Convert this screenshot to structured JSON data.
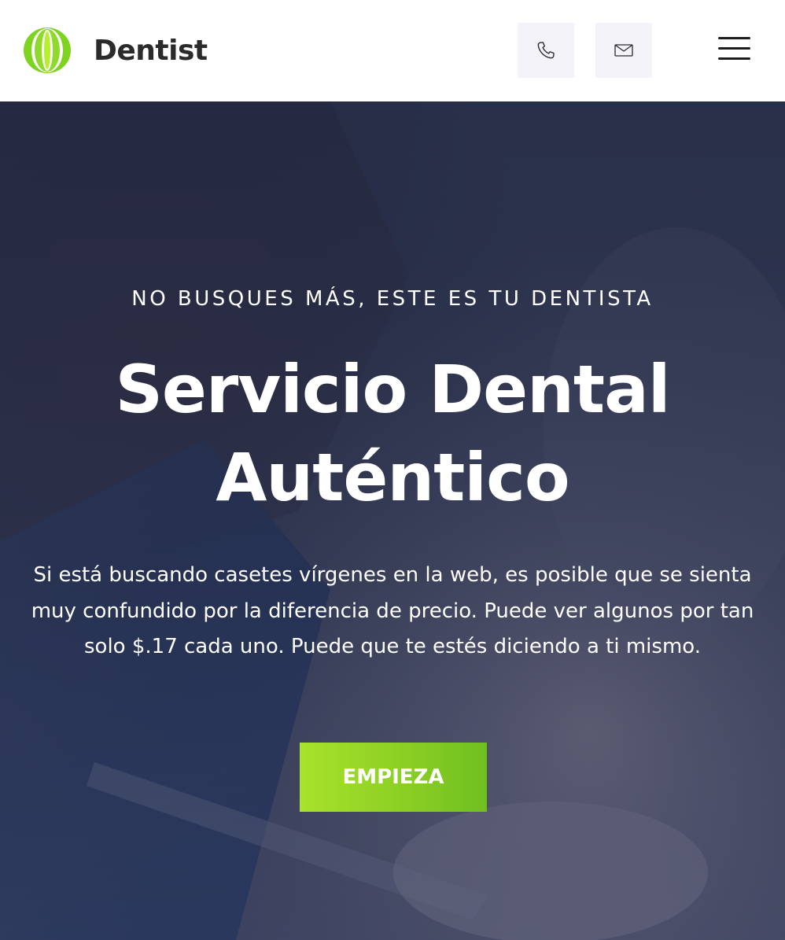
{
  "brand": {
    "name": "Dentist",
    "logo_icon": "tooth-leaf-logo-icon",
    "logo_colors": [
      "#7ed321",
      "#b7ef2e"
    ]
  },
  "header": {
    "contact_icons": [
      "phone-icon",
      "mail-icon"
    ],
    "menu_icon": "hamburger-menu-icon"
  },
  "hero": {
    "eyebrow": "NO BUSQUES MÁS, ESTE ES TU DENTISTA",
    "headline": "Servicio Dental Auténtico",
    "description": "Si está buscando casetes vírgenes en la web, es posible que se sienta muy confundido por la diferencia de precio. Puede ver algunos por tan solo $.17 cada uno. Puede que te estés diciendo a ti mismo.",
    "cta_label": "EMPIEZA"
  },
  "colors": {
    "accent_green": "#8ccf24",
    "overlay_navy": "#1a2444",
    "icon_box_bg": "#f3f3f9",
    "text_dark": "#2b2b2b"
  }
}
